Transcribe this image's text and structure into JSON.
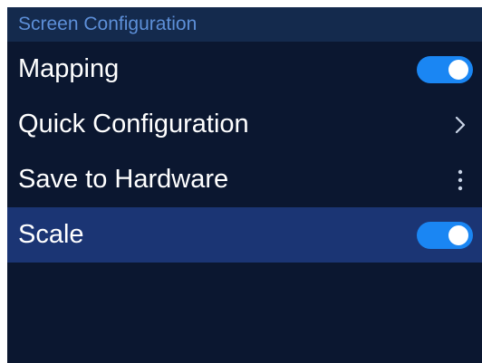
{
  "section": {
    "title": "Screen Configuration"
  },
  "items": [
    {
      "label": "Mapping",
      "control": "toggle",
      "state": "on"
    },
    {
      "label": "Quick Configuration",
      "control": "chevron-right-icon"
    },
    {
      "label": "Save to Hardware",
      "control": "more-vertical-icon"
    },
    {
      "label": "Scale",
      "control": "toggle",
      "state": "on",
      "selected": true
    }
  ],
  "colors": {
    "background": "#0b1730",
    "header_background": "#142a4d",
    "header_text": "#5d8fd8",
    "selected_row": "#1b3574",
    "toggle_on": "#1a86f3",
    "text": "#ffffff"
  }
}
